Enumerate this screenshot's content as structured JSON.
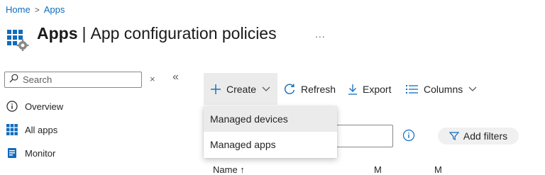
{
  "breadcrumb": {
    "home": "Home",
    "separator": ">",
    "current": "Apps"
  },
  "header": {
    "title_bold": "Apps",
    "title_separator": "|",
    "title_rest": "App configuration policies",
    "more": "..."
  },
  "sidebar": {
    "search_placeholder": "Search",
    "collapse_close": "×",
    "collapse_left": "«",
    "items": [
      {
        "label": "Overview",
        "icon": "info-circle-icon"
      },
      {
        "label": "All apps",
        "icon": "grid-icon"
      },
      {
        "label": "Monitor",
        "icon": "monitor-icon"
      }
    ]
  },
  "toolbar": {
    "create_label": "Create",
    "refresh_label": "Refresh",
    "export_label": "Export",
    "columns_label": "Columns"
  },
  "create_menu": {
    "items": [
      "Managed devices",
      "Managed apps"
    ]
  },
  "filters": {
    "add_filters_label": "Add filters"
  },
  "table": {
    "headers": [
      "Name ↑",
      "M",
      "M"
    ]
  },
  "colors": {
    "accent": "#0f6cbd",
    "hover": "#ebebeb",
    "text": "#242424"
  }
}
